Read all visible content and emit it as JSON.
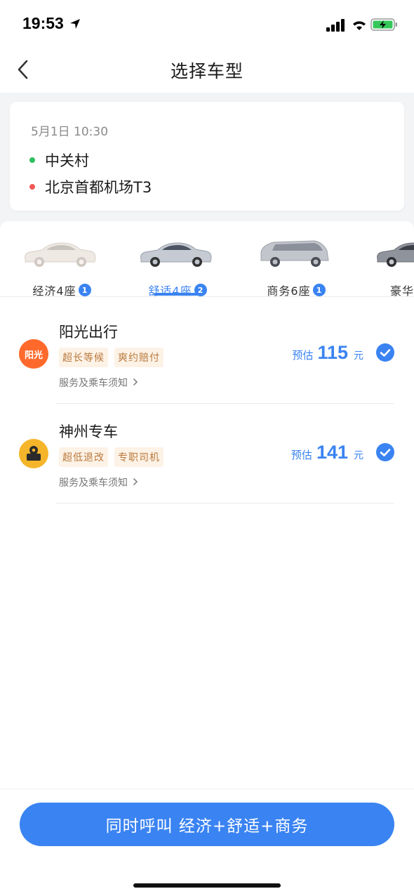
{
  "status_bar": {
    "time": "19:53"
  },
  "nav": {
    "title": "选择车型"
  },
  "trip": {
    "time": "5月1日 10:30",
    "from": "中关村",
    "to": "北京首都机场T3"
  },
  "car_tabs": [
    {
      "label": "经济4座",
      "badge": "1",
      "active": false
    },
    {
      "label": "舒适4座",
      "badge": "2",
      "active": true
    },
    {
      "label": "商务6座",
      "badge": "1",
      "active": false
    },
    {
      "label": "豪华",
      "badge": "",
      "active": false
    }
  ],
  "providers": [
    {
      "name": "阳光出行",
      "logo_text": "阳光",
      "tags": [
        "超长等候",
        "爽约赔付"
      ],
      "service": "服务及乘车须知",
      "price_prefix": "预估",
      "price": "115",
      "unit": "元",
      "checked": true
    },
    {
      "name": "神州专车",
      "logo_text": "",
      "tags": [
        "超低退改",
        "专职司机"
      ],
      "service": "服务及乘车须知",
      "price_prefix": "预估",
      "price": "141",
      "unit": "元",
      "checked": true
    }
  ],
  "call_button": {
    "label": "同时呼叫 经济+舒适+商务"
  },
  "colors": {
    "accent": "#3a83f2",
    "tag_bg": "#fdf2e6",
    "tag_text": "#b9793d",
    "dot_from": "#2fbf5f",
    "dot_to": "#f25757",
    "sunshine_logo": "#ff6a2c",
    "shenzhou_logo": "#f5b52b"
  },
  "icons": [
    "location-arrow-icon",
    "signal-icon",
    "wifi-icon",
    "battery-charging-icon",
    "back-chevron-icon",
    "check-circle-icon",
    "chevron-right-icon"
  ]
}
